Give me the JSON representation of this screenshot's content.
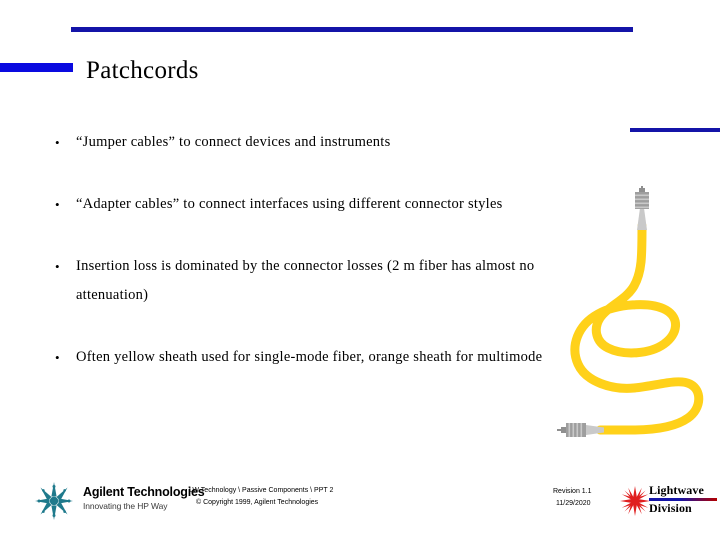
{
  "slide": {
    "title": "Patchcords",
    "bullets": [
      {
        "text": "“Jumper cables” to connect devices and instruments",
        "marker": "•"
      },
      {
        "text": "“Adapter cables” to connect interfaces using different connector styles",
        "marker": "•"
      },
      {
        "text": "Insertion loss is dominated by the connector losses (2 m fiber has almost no attenuation)",
        "marker": "•"
      },
      {
        "text": "Often yellow sheath used for single-mode fiber, orange sheath for multimode",
        "marker": "•"
      }
    ]
  },
  "artwork": {
    "name": "fiber-patchcord-illustration",
    "sheath_color": "#FFD11A",
    "connector_body_color": "#9E9E9E",
    "connector_boot_color": "#C4C4C4",
    "connector_count": 2
  },
  "footer": {
    "agilent": {
      "name": "Agilent Technologies",
      "tagline": "Innovating the HP Way",
      "logo_color": "#1F7A8C"
    },
    "document_path": "LW Technology \\ Passive Components \\ PPT   2",
    "copyright": "© Copyright 1999, Agilent Technologies",
    "revision_label": "Revision 1.1",
    "revision_date": "11/29/2020",
    "lightwave": {
      "line1": "Lightwave",
      "line2": "Division",
      "star_color": "#E02020",
      "bar_left_color": "#1414a8",
      "bar_right_color": "#b40000"
    }
  },
  "theme": {
    "rule_blue": "#1414a8",
    "accent_blue": "#0a0ae0",
    "text_black": "#000000",
    "background": "#ffffff"
  }
}
